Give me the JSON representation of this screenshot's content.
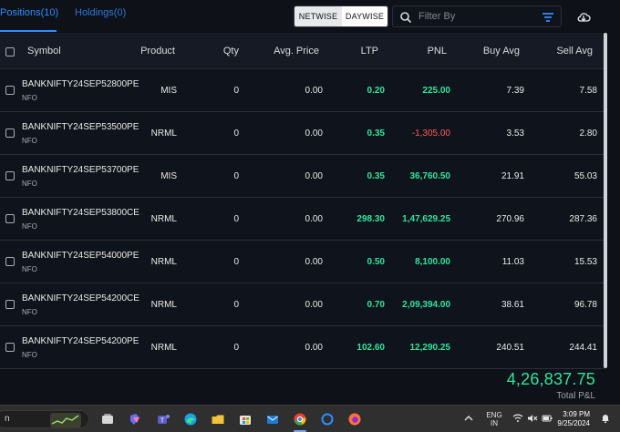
{
  "tabs": {
    "positions_label": "Positions(10)",
    "holdings_label": "Holdings(0)"
  },
  "toolbar": {
    "netwise_label": "NETWISE",
    "daywise_label": "DAYWISE",
    "filter_placeholder": "Filter By"
  },
  "table": {
    "headers": {
      "symbol": "Symbol",
      "product": "Product",
      "qty": "Qty",
      "avg_price": "Avg. Price",
      "ltp": "LTP",
      "pnl": "PNL",
      "buy_avg": "Buy Avg",
      "sell_avg": "Sell Avg"
    },
    "rows": [
      {
        "symbol": "BANKNIFTY24SEP52800PE",
        "exchange": "NFO",
        "product": "MIS",
        "qty": "0",
        "avg_price": "0.00",
        "ltp": "0.20",
        "pnl": "225.00",
        "buy_avg": "7.39",
        "sell_avg": "7.58"
      },
      {
        "symbol": "BANKNIFTY24SEP53500PE",
        "exchange": "NFO",
        "product": "NRML",
        "qty": "0",
        "avg_price": "0.00",
        "ltp": "0.35",
        "pnl": "-1,305.00",
        "buy_avg": "3.53",
        "sell_avg": "2.80"
      },
      {
        "symbol": "BANKNIFTY24SEP53700PE",
        "exchange": "NFO",
        "product": "MIS",
        "qty": "0",
        "avg_price": "0.00",
        "ltp": "0.35",
        "pnl": "36,760.50",
        "buy_avg": "21.91",
        "sell_avg": "55.03"
      },
      {
        "symbol": "BANKNIFTY24SEP53800CE",
        "exchange": "NFO",
        "product": "NRML",
        "qty": "0",
        "avg_price": "0.00",
        "ltp": "298.30",
        "pnl": "1,47,629.25",
        "buy_avg": "270.96",
        "sell_avg": "287.36"
      },
      {
        "symbol": "BANKNIFTY24SEP54000PE",
        "exchange": "NFO",
        "product": "NRML",
        "qty": "0",
        "avg_price": "0.00",
        "ltp": "0.50",
        "pnl": "8,100.00",
        "buy_avg": "11.03",
        "sell_avg": "15.53"
      },
      {
        "symbol": "BANKNIFTY24SEP54200CE",
        "exchange": "NFO",
        "product": "NRML",
        "qty": "0",
        "avg_price": "0.00",
        "ltp": "0.70",
        "pnl": "2,09,394.00",
        "buy_avg": "38.61",
        "sell_avg": "96.78"
      },
      {
        "symbol": "BANKNIFTY24SEP54200PE",
        "exchange": "NFO",
        "product": "NRML",
        "qty": "0",
        "avg_price": "0.00",
        "ltp": "102.60",
        "pnl": "12,290.25",
        "buy_avg": "240.51",
        "sell_avg": "244.41"
      }
    ]
  },
  "summary": {
    "total_pnl_value": "4,26,837.75",
    "total_pnl_label": "Total P&L"
  },
  "taskbar": {
    "search_text": "n",
    "lang_top": "ENG",
    "lang_bottom": "IN",
    "time": "3:09 PM",
    "date": "9/25/2024"
  },
  "colors": {
    "accent": "#2f8cff",
    "profit": "#2ee59d",
    "loss": "#ff5b5b",
    "background": "#0e1117"
  }
}
